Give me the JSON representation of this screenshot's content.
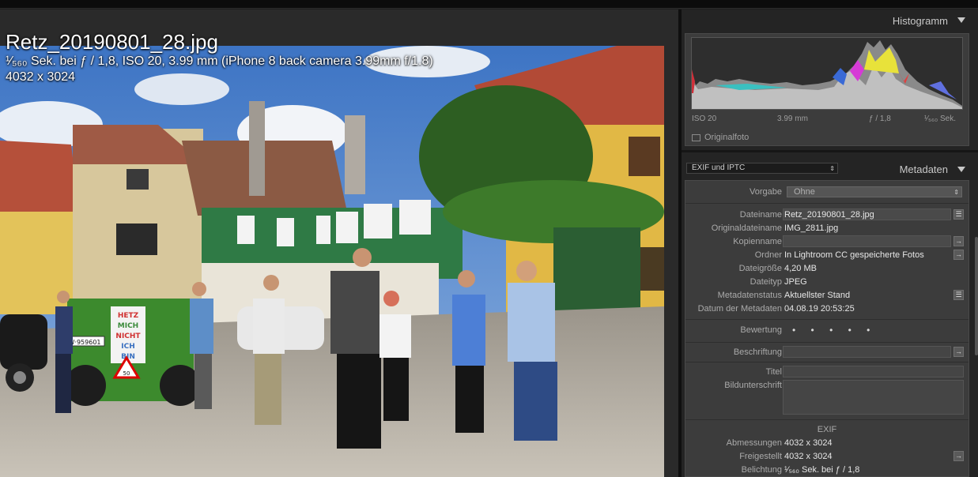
{
  "photo": {
    "filename": "Retz_20190801_28.jpg",
    "exposure_line": "¹⁄₅₆₀ Sek. bei ƒ / 1,8, ISO 20, 3.99 mm (iPhone 8 back camera 3.99mm f/1.8)",
    "dimensions_line": "4032 x 3024",
    "sign_text": [
      "HETZ",
      "MICH",
      "NICHT",
      "ICH",
      "BIN"
    ],
    "plate_text": "W·959601",
    "speed_sign": "50"
  },
  "histogram": {
    "title": "Histogramm",
    "iso": "ISO 20",
    "focal": "3.99 mm",
    "aperture": "ƒ / 1,8",
    "shutter": "¹⁄₅₆₀ Sek.",
    "original_label": "Originalfoto"
  },
  "metadata": {
    "preset_dropdown": "EXIF und IPTC",
    "title": "Metadaten",
    "vorgabe_label": "Vorgabe",
    "vorgabe_value": "Ohne",
    "fields": {
      "dateiname": {
        "label": "Dateiname",
        "value": "Retz_20190801_28.jpg"
      },
      "originaldateiname": {
        "label": "Originaldateiname",
        "value": "IMG_2811.jpg"
      },
      "kopienname": {
        "label": "Kopienname",
        "value": ""
      },
      "ordner": {
        "label": "Ordner",
        "value": "In Lightroom CC gespeicherte Fotos"
      },
      "dateigroesse": {
        "label": "Dateigröße",
        "value": "4,20 MB"
      },
      "dateityp": {
        "label": "Dateityp",
        "value": "JPEG"
      },
      "metadatenstatus": {
        "label": "Metadatenstatus",
        "value": "Aktuellster Stand"
      },
      "datum": {
        "label": "Datum der Metadaten",
        "value": "04.08.19 20:53:25"
      }
    },
    "bewertung_label": "Bewertung",
    "bewertung_value": "• • • • •",
    "beschriftung_label": "Beschriftung",
    "titel_label": "Titel",
    "bildunterschrift_label": "Bildunterschrift",
    "exif_header": "EXIF",
    "abmessungen": {
      "label": "Abmessungen",
      "value": "4032 x 3024"
    },
    "freigestellt": {
      "label": "Freigestellt",
      "value": "4032 x 3024"
    },
    "belichtung": {
      "label": "Belichtung",
      "value": "¹⁄₅₆₀ Sek. bei ƒ / 1,8"
    }
  }
}
